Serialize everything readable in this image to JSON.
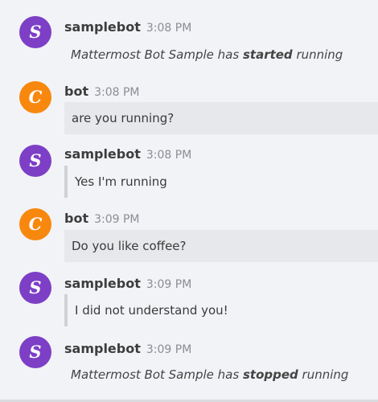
{
  "messages": [
    {
      "author": "samplebot",
      "time": "3:08 PM",
      "avatar_letter": "S",
      "avatar_color": "#7c3fc6",
      "system": {
        "prefix": "Mattermost Bot Sample has ",
        "emphasis": "started",
        "suffix": " running"
      }
    },
    {
      "author": "bot",
      "time": "3:08 PM",
      "avatar_letter": "C",
      "avatar_color": "#f7880d",
      "text": "are you running?"
    },
    {
      "author": "samplebot",
      "time": "3:08 PM",
      "avatar_letter": "S",
      "avatar_color": "#7c3fc6",
      "text": "Yes I'm running"
    },
    {
      "author": "bot",
      "time": "3:09 PM",
      "avatar_letter": "C",
      "avatar_color": "#f7880d",
      "text": "Do you like coffee?"
    },
    {
      "author": "samplebot",
      "time": "3:09 PM",
      "avatar_letter": "S",
      "avatar_color": "#7c3fc6",
      "text": "I did not understand you!"
    },
    {
      "author": "samplebot",
      "time": "3:09 PM",
      "avatar_letter": "S",
      "avatar_color": "#7c3fc6",
      "system": {
        "prefix": "Mattermost Bot Sample has ",
        "emphasis": "stopped",
        "suffix": " running"
      }
    }
  ]
}
